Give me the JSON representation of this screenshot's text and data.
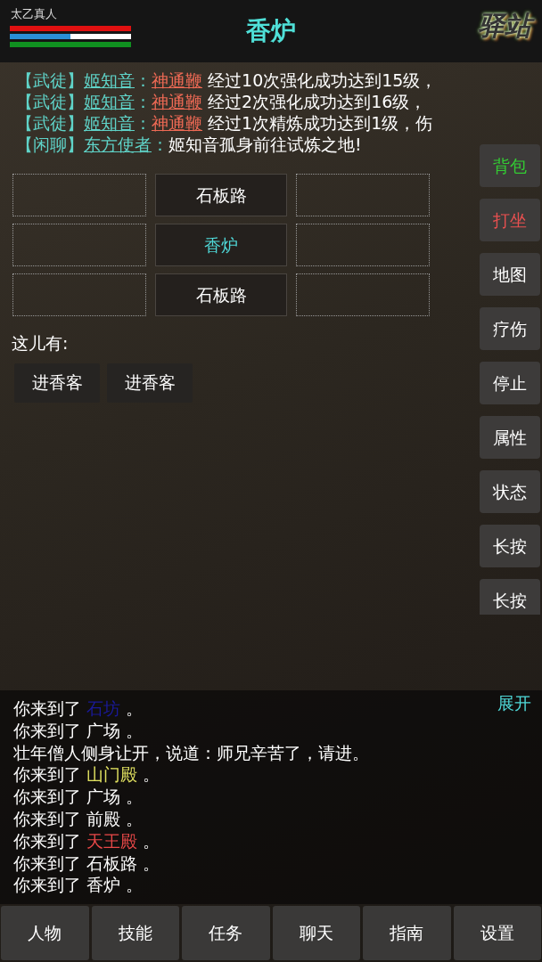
{
  "player": {
    "name": "太乙真人",
    "bars": [
      {
        "kind": "hp",
        "level": 1
      },
      {
        "kind": "mp",
        "level": 0.5
      },
      {
        "kind": "exp",
        "level": 1
      }
    ]
  },
  "location": {
    "title": "香炉"
  },
  "logo": {
    "text": "驿站"
  },
  "chat": [
    {
      "channel": "【武徒】",
      "name": "姬知音",
      "separator": "：",
      "item": "神通鞭",
      "message": "经过10次强化成功达到15级，"
    },
    {
      "channel": "【武徒】",
      "name": "姬知音",
      "separator": "：",
      "item": "神通鞭",
      "message": "经过2次强化成功达到16级，"
    },
    {
      "channel": "【武徒】",
      "name": "姬知音",
      "separator": "：",
      "item": "神通鞭",
      "message": "经过1次精炼成功达到1级，伤"
    },
    {
      "channel": "【闲聊】",
      "name": "东方使者",
      "separator": "：",
      "message": "姬知音孤身前往试炼之地!"
    }
  ],
  "map": {
    "cells": [
      {
        "kind": "empty"
      },
      {
        "kind": "exit",
        "label": "石板路",
        "selected": false
      },
      {
        "kind": "empty"
      },
      {
        "kind": "empty"
      },
      {
        "kind": "exit",
        "label": "香炉",
        "selected": true
      },
      {
        "kind": "empty"
      },
      {
        "kind": "empty"
      },
      {
        "kind": "exit",
        "label": "石板路",
        "selected": false
      },
      {
        "kind": "empty"
      }
    ]
  },
  "here": {
    "label": "这儿有:",
    "npcs": [
      "进香客",
      "进香客"
    ]
  },
  "side_buttons": [
    {
      "label": "背包",
      "color": "#33cc33"
    },
    {
      "label": "打坐",
      "color": "#e85050"
    },
    {
      "label": "地图"
    },
    {
      "label": "疗伤"
    },
    {
      "label": "停止"
    },
    {
      "label": "属性"
    },
    {
      "label": "状态"
    },
    {
      "label": "长按"
    },
    {
      "label": "长按"
    }
  ],
  "log": {
    "expand": "展开",
    "lines": [
      {
        "text": "你来到了",
        "place": "石坊",
        "color": "#1a1a9a",
        "end": "。"
      },
      {
        "text": "你来到了",
        "place": "广场",
        "color": "#ffffff",
        "end": "。"
      },
      {
        "text": "壮年僧人侧身让开，说道：师兄辛苦了，请进。"
      },
      {
        "text": "你来到了",
        "place": "山门殿",
        "color": "#e0e060",
        "end": "。"
      },
      {
        "text": "你来到了",
        "place": "广场",
        "color": "#ffffff",
        "end": "。"
      },
      {
        "text": "你来到了",
        "place": "前殿",
        "color": "#ffffff",
        "end": "。"
      },
      {
        "text": "你来到了",
        "place": "天王殿",
        "color": "#e84848",
        "end": "。"
      },
      {
        "text": "你来到了",
        "place": "石板路",
        "color": "#ffffff",
        "end": "。"
      },
      {
        "text": "你来到了",
        "place": "香炉",
        "color": "#ffffff",
        "end": "。"
      }
    ]
  },
  "tabs": [
    "人物",
    "技能",
    "任务",
    "聊天",
    "指南",
    "设置"
  ]
}
